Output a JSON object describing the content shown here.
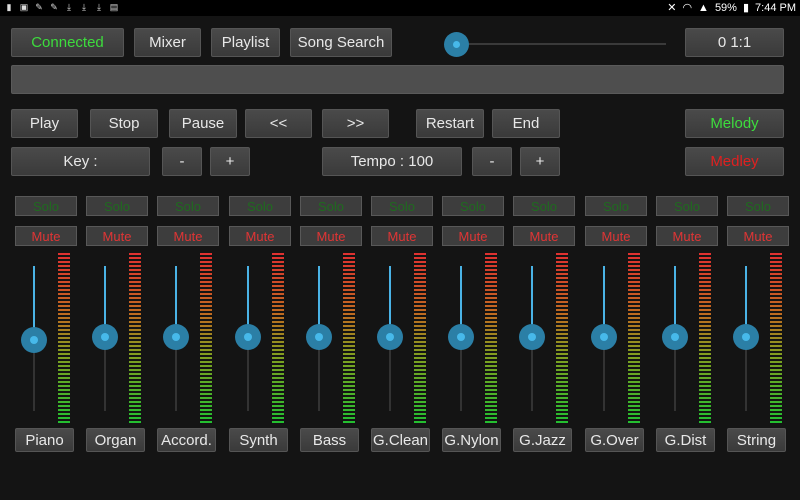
{
  "status_bar": {
    "icons": [
      "notification-icon",
      "image-icon",
      "paint-icon",
      "paint-icon",
      "download-icon",
      "download-icon",
      "download-icon",
      "briefcase-icon"
    ],
    "battery": "59%",
    "time": "7:44 PM"
  },
  "top": {
    "connected_label": "Connected",
    "mixer_label": "Mixer",
    "playlist_label": "Playlist",
    "song_search_label": "Song Search",
    "position": "0  1:1",
    "seek_progress": 0.0
  },
  "transport": {
    "play": "Play",
    "stop": "Stop",
    "pause": "Pause",
    "rewind": "<<",
    "forward": ">>",
    "restart": "Restart",
    "end": "End",
    "melody": "Melody",
    "medley": "Medley"
  },
  "key_row": {
    "key_label": "Key :",
    "minus": "-",
    "plus": "+",
    "tempo_label": "Tempo : 100",
    "tempo_minus": "-",
    "tempo_plus": "+"
  },
  "channels": {
    "solo_label": "Solo",
    "mute_label": "Mute",
    "items": [
      {
        "name": "Piano",
        "level": 0.49
      },
      {
        "name": "Organ",
        "level": 0.51
      },
      {
        "name": "Accord.",
        "level": 0.51
      },
      {
        "name": "Synth",
        "level": 0.51
      },
      {
        "name": "Bass",
        "level": 0.51
      },
      {
        "name": "G.Clean",
        "level": 0.51
      },
      {
        "name": "G.Nylon",
        "level": 0.51
      },
      {
        "name": "G.Jazz",
        "level": 0.51
      },
      {
        "name": "G.Over",
        "level": 0.51
      },
      {
        "name": "G.Dist",
        "level": 0.51
      },
      {
        "name": "String",
        "level": 0.51
      }
    ]
  },
  "colors": {
    "connected": "#3ddc3d",
    "medley": "#e02020",
    "accent": "#47b9ea"
  }
}
